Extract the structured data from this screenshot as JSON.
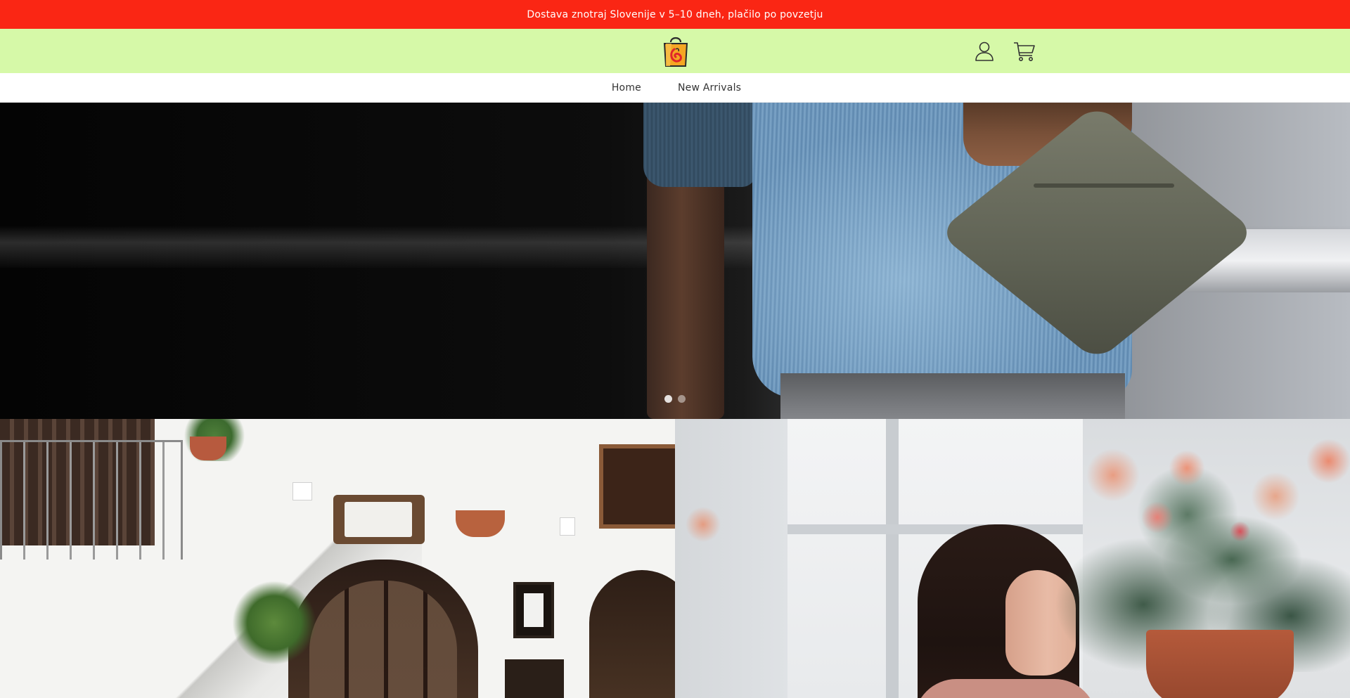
{
  "announcement": {
    "text": "Dostava znotraj Slovenije v 5–10 dneh, plačilo po povzetju"
  },
  "header": {
    "logo_icon": "shopping-bag-logo-icon",
    "account_icon": "user-account-icon",
    "cart_icon": "shopping-cart-icon"
  },
  "nav": {
    "items": [
      {
        "label": "Home"
      },
      {
        "label": "New Arrivals"
      }
    ]
  },
  "hero": {
    "slides_count": 2,
    "active_slide": 1
  },
  "colors": {
    "announcement_bg": "#fa2614",
    "header_bg": "#d6f9a8",
    "nav_bg": "#ffffff"
  }
}
